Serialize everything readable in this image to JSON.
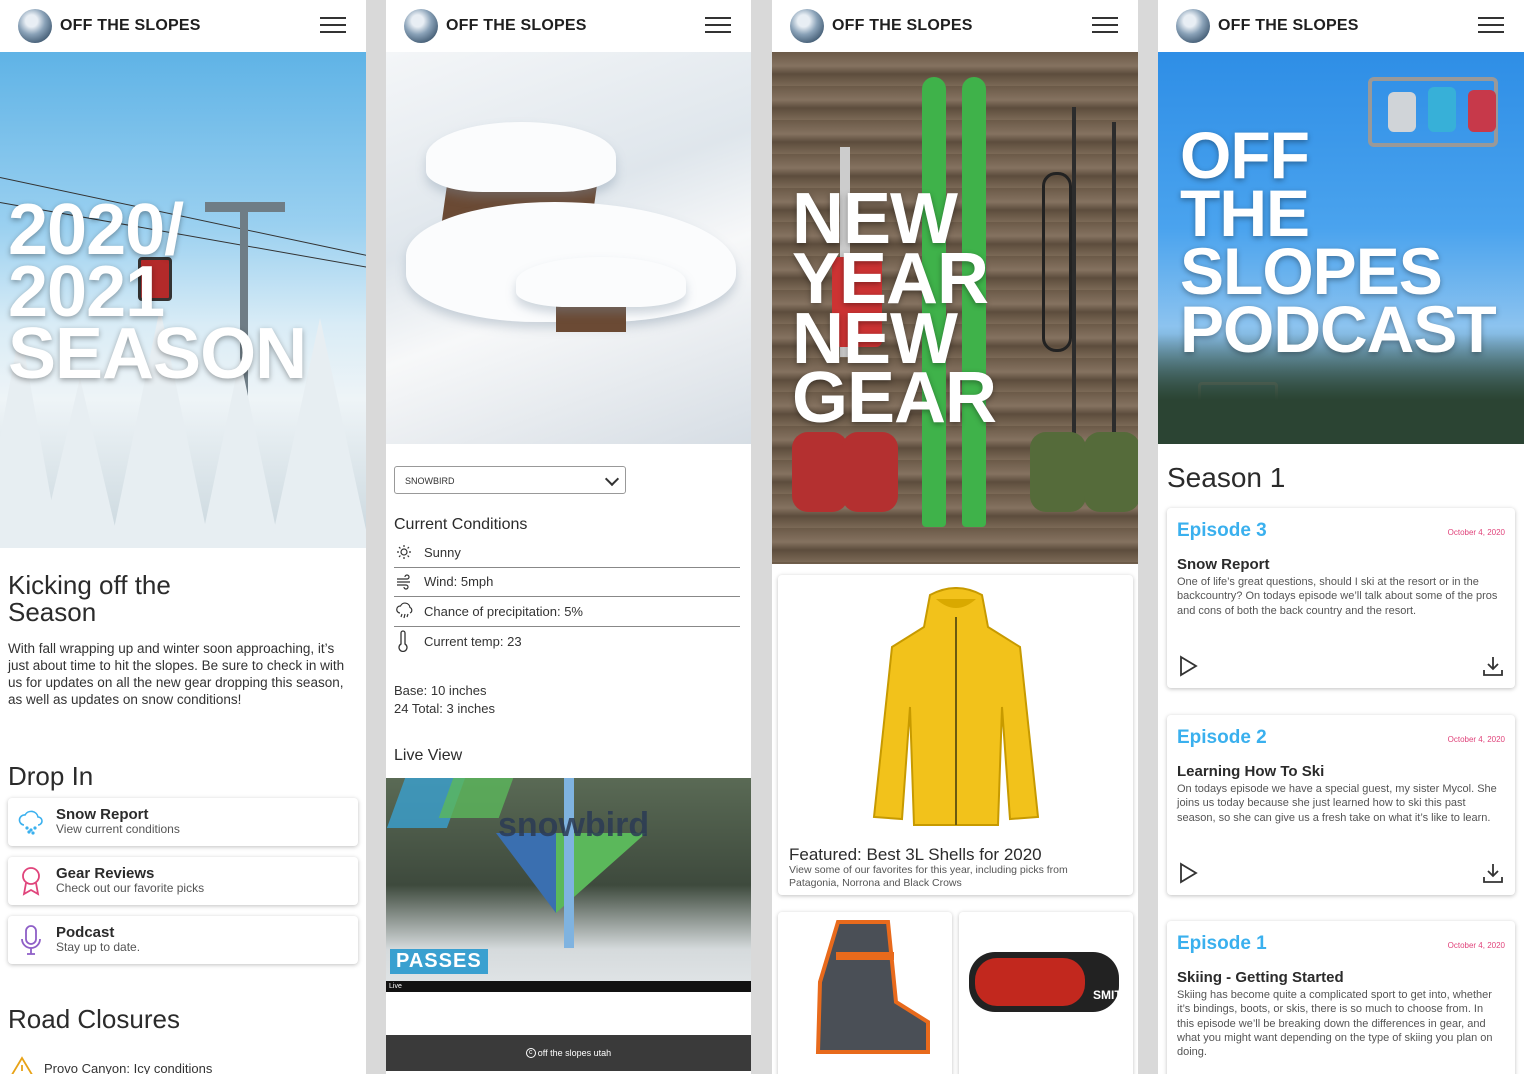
{
  "brand": "OFF THE SLOPES",
  "screen1": {
    "hero_lines": [
      "2020/",
      "2021",
      "SEASON"
    ],
    "heading_lines": [
      "Kicking off the",
      "Season"
    ],
    "paragraph": "With fall wrapping up and winter soon approaching, it’s just about time to hit the slopes. Be sure to check in with us for updates on all the new gear dropping this season, as well as updates on snow conditions!",
    "drop_in_title": "Drop In",
    "drop_in": [
      {
        "title": "Snow Report",
        "subtitle": "View current conditions",
        "icon": "cloud-snow-icon",
        "color": "#3ab0ee"
      },
      {
        "title": "Gear Reviews",
        "subtitle": "Check out our favorite picks",
        "icon": "award-ribbon-icon",
        "color": "#e0447b"
      },
      {
        "title": "Podcast",
        "subtitle": "Stay up to date.",
        "icon": "microphone-icon",
        "color": "#8e5fc7"
      }
    ],
    "road_title": "Road Closures",
    "road_items": [
      "Provo Canyon: Icy conditions"
    ]
  },
  "screen2": {
    "resort_select": "SNOWBIRD",
    "conditions_title": "Current Conditions",
    "conditions": [
      {
        "icon": "sun-icon",
        "text": "Sunny"
      },
      {
        "icon": "wind-icon",
        "text": "Wind: 5mph"
      },
      {
        "icon": "cloud-rain-icon",
        "text": "Chance of precipitation: 5%"
      },
      {
        "icon": "thermometer-icon",
        "text": "Current temp: 23"
      }
    ],
    "base": "Base: 10 inches",
    "total24": "24 Total: 3 inches",
    "live_title": "Live View",
    "cam_sign": "snowbird",
    "cam_passes": "PASSES",
    "cam_live": "Live",
    "footer": "off the slopes utah"
  },
  "screen3": {
    "hero_lines": [
      "NEW",
      "YEAR",
      "NEW",
      "GEAR"
    ],
    "featured_title": "Featured: Best 3L Shells for 2020",
    "featured_sub": "View some of our favorites for this year, including picks from Patagonia, Norrona and Black Crows",
    "goggle_brand": "SMITH"
  },
  "screen4": {
    "hero_lines": [
      "OFF",
      "THE",
      "SLOPES",
      "PODCAST"
    ],
    "season_title": "Season 1",
    "episodes": [
      {
        "number": "Episode 3",
        "date": "October 4, 2020",
        "title": "Snow Report",
        "desc": "One of life’s great questions, should I ski at the resort or in the backcountry? On todays episode we’ll talk about some of the pros and cons of both the back country and the resort."
      },
      {
        "number": "Episode 2",
        "date": "October 4, 2020",
        "title": "Learning How To Ski",
        "desc": "On todays episode we have a special guest, my sister Mycol. She joins us today because she just learned how to ski this past season, so she can give us a fresh take on what it’s like to learn."
      },
      {
        "number": "Episode 1",
        "date": "October 4, 2020",
        "title": "Skiing - Getting Started",
        "desc": "Skiing has become quite a complicated sport to get into, whether it’s bindings, boots, or skis, there is so much to choose from. In this episode we’ll be breaking down the differences in gear, and what you might want depending on the type of skiing you plan on doing."
      }
    ]
  }
}
